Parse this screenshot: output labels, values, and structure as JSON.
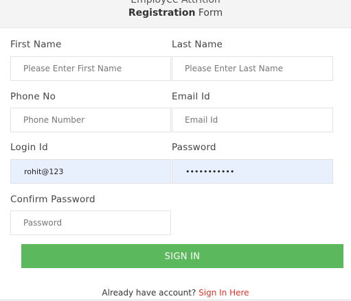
{
  "header": {
    "title_line1": "Employee Attrition",
    "title_bold": "Registration",
    "title_rest": " Form"
  },
  "form": {
    "first_name": {
      "label": "First Name",
      "placeholder": "Please Enter First Name"
    },
    "last_name": {
      "label": "Last Name",
      "placeholder": "Please Enter Last Name"
    },
    "phone": {
      "label": "Phone No",
      "placeholder": "Phone Number"
    },
    "email": {
      "label": "Email Id",
      "placeholder": "Email Id"
    },
    "login": {
      "label": "Login Id",
      "value": "rohit@123"
    },
    "password": {
      "label": "Password",
      "value": "•••••••••••"
    },
    "confirm_password": {
      "label": "Confirm Password",
      "placeholder": "Password"
    }
  },
  "submit": {
    "label": "SIGN IN",
    "color": "#5cb85c"
  },
  "footer": {
    "prompt": "Already have account? ",
    "link": "Sign In Here",
    "link_color": "#e0322b"
  }
}
